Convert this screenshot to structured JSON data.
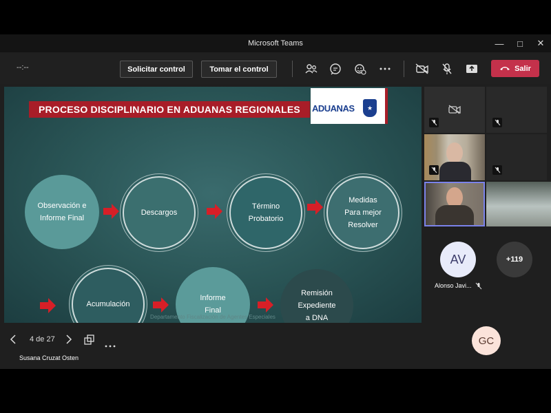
{
  "window": {
    "title": "Microsoft Teams"
  },
  "toolbar": {
    "timer": "--:--",
    "request_control": "Solicitar control",
    "take_control": "Tomar el control",
    "leave_label": "Salir"
  },
  "slide": {
    "title": "PROCESO DISCIPLINARIO EN ADUANAS REGIONALES",
    "logo_text": "ADUANAS",
    "footer": "Departamento Fiscalización de Agentes Especiales",
    "steps": [
      {
        "line1": "Observación e",
        "line2": "Informe Final",
        "line3": ""
      },
      {
        "line1": "Descargos",
        "line2": "",
        "line3": ""
      },
      {
        "line1": "Término",
        "line2": "Probatorio",
        "line3": ""
      },
      {
        "line1": "Medidas",
        "line2": "Para mejor",
        "line3": "Resolver"
      },
      {
        "line1": "Acumulación",
        "line2": "",
        "line3": ""
      },
      {
        "line1": "Informe",
        "line2": "Final",
        "line3": ""
      },
      {
        "line1": "Remisión",
        "line2": "Expediente",
        "line3": "a DNA"
      }
    ]
  },
  "slide_controls": {
    "page": "4 de 27"
  },
  "presenter": {
    "name": "Susana Cruzat Osten"
  },
  "participants": {
    "av_initials": "AV",
    "av_name": "Alonso Javi...",
    "overflow_count": "+119",
    "gc_initials": "GC"
  },
  "colors": {
    "leave": "#c4314b",
    "title_bar": "#a81d28",
    "arrow": "#d71f27"
  }
}
